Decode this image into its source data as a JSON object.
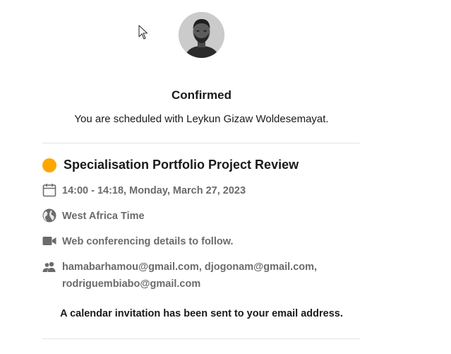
{
  "header": {
    "status": "Confirmed",
    "message": "You are scheduled with Leykun Gizaw Woldesemayat."
  },
  "event": {
    "title": "Specialisation Portfolio Project Review",
    "accent_color": "#ffa600",
    "datetime": "14:00 - 14:18, Monday, March 27, 2023",
    "timezone": "West Africa Time",
    "location": "Web conferencing details to follow.",
    "invitees_line1": "hamabarhamou@gmail.com, djogonam@gmail.com,",
    "invitees_line2": "rodriguembiabo@gmail.com"
  },
  "footer": {
    "invitation_note": "A calendar invitation has been sent to your email address."
  },
  "icons": {
    "cursor": "mouse-pointer-icon",
    "datetime": "calendar-icon",
    "timezone": "globe-icon",
    "location": "video-camera-icon",
    "invitees": "people-icon"
  }
}
